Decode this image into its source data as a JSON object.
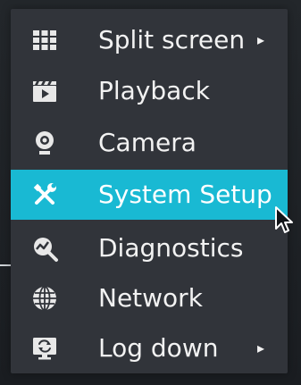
{
  "menu": {
    "items": [
      {
        "label": "Split screen",
        "icon": "split-grid-icon",
        "has_submenu": true,
        "selected": false
      },
      {
        "label": "Playback",
        "icon": "clapperboard-icon",
        "has_submenu": false,
        "selected": false
      },
      {
        "label": "Camera",
        "icon": "webcam-icon",
        "has_submenu": false,
        "selected": false
      },
      {
        "label": "System Setup",
        "icon": "wrench-screwdriver-icon",
        "has_submenu": false,
        "selected": true
      },
      {
        "label": "Diagnostics",
        "icon": "magnifier-graph-icon",
        "has_submenu": false,
        "selected": false
      },
      {
        "label": "Network",
        "icon": "globe-icon",
        "has_submenu": false,
        "selected": false
      },
      {
        "label": "Log down",
        "icon": "monitor-cycle-icon",
        "has_submenu": true,
        "selected": false
      }
    ],
    "submenu_arrow": "▸"
  },
  "colors": {
    "menu_bg": "#31343a",
    "selected_bg": "#19b9d3",
    "text": "#f2f2f2"
  }
}
